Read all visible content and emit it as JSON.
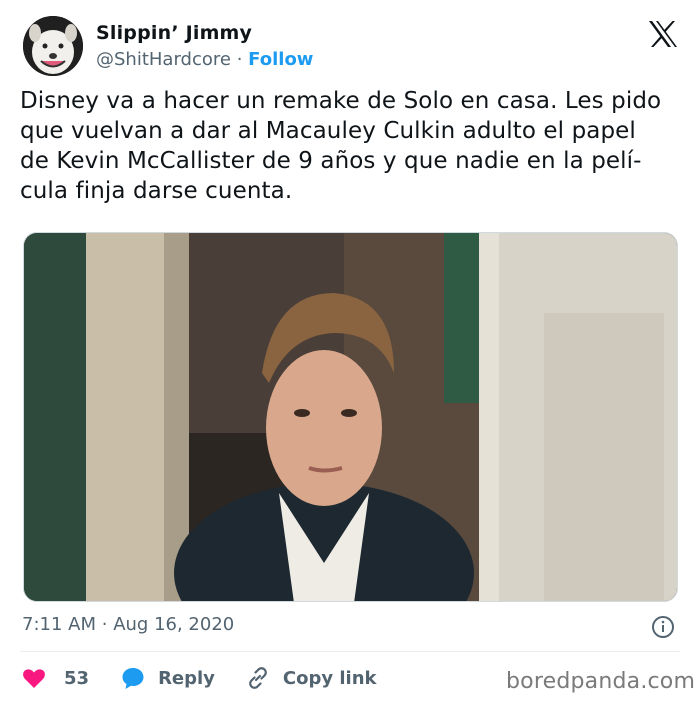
{
  "author": {
    "name": "Slippin’ Jimmy",
    "handle": "@ShitHardcore",
    "separator": "·",
    "follow_label": "Follow"
  },
  "platform_icon": "x-logo-icon",
  "tweet": {
    "text": "Disney va a hacer un remake de Solo en casa. Les pido\nque vuelvan a dar al Macauley Culkin adulto el papel\nde Kevin McCallister de 9 años y que nadie en la pelí-\ncula finja darse cuenta."
  },
  "timestamp": {
    "time": "7:11 AM",
    "separator": "·",
    "date": "Aug 16, 2020"
  },
  "actions": {
    "like_count": "53",
    "reply_label": "Reply",
    "copy_link_label": "Copy link"
  },
  "icons": {
    "like": "heart-icon",
    "reply": "speech-bubble-icon",
    "copy": "link-icon",
    "info": "info-icon"
  },
  "colors": {
    "like": "#f91880",
    "reply": "#1d9bf0",
    "follow": "#1d9bf0",
    "muted": "#536471"
  },
  "watermark": "boredpanda.com"
}
